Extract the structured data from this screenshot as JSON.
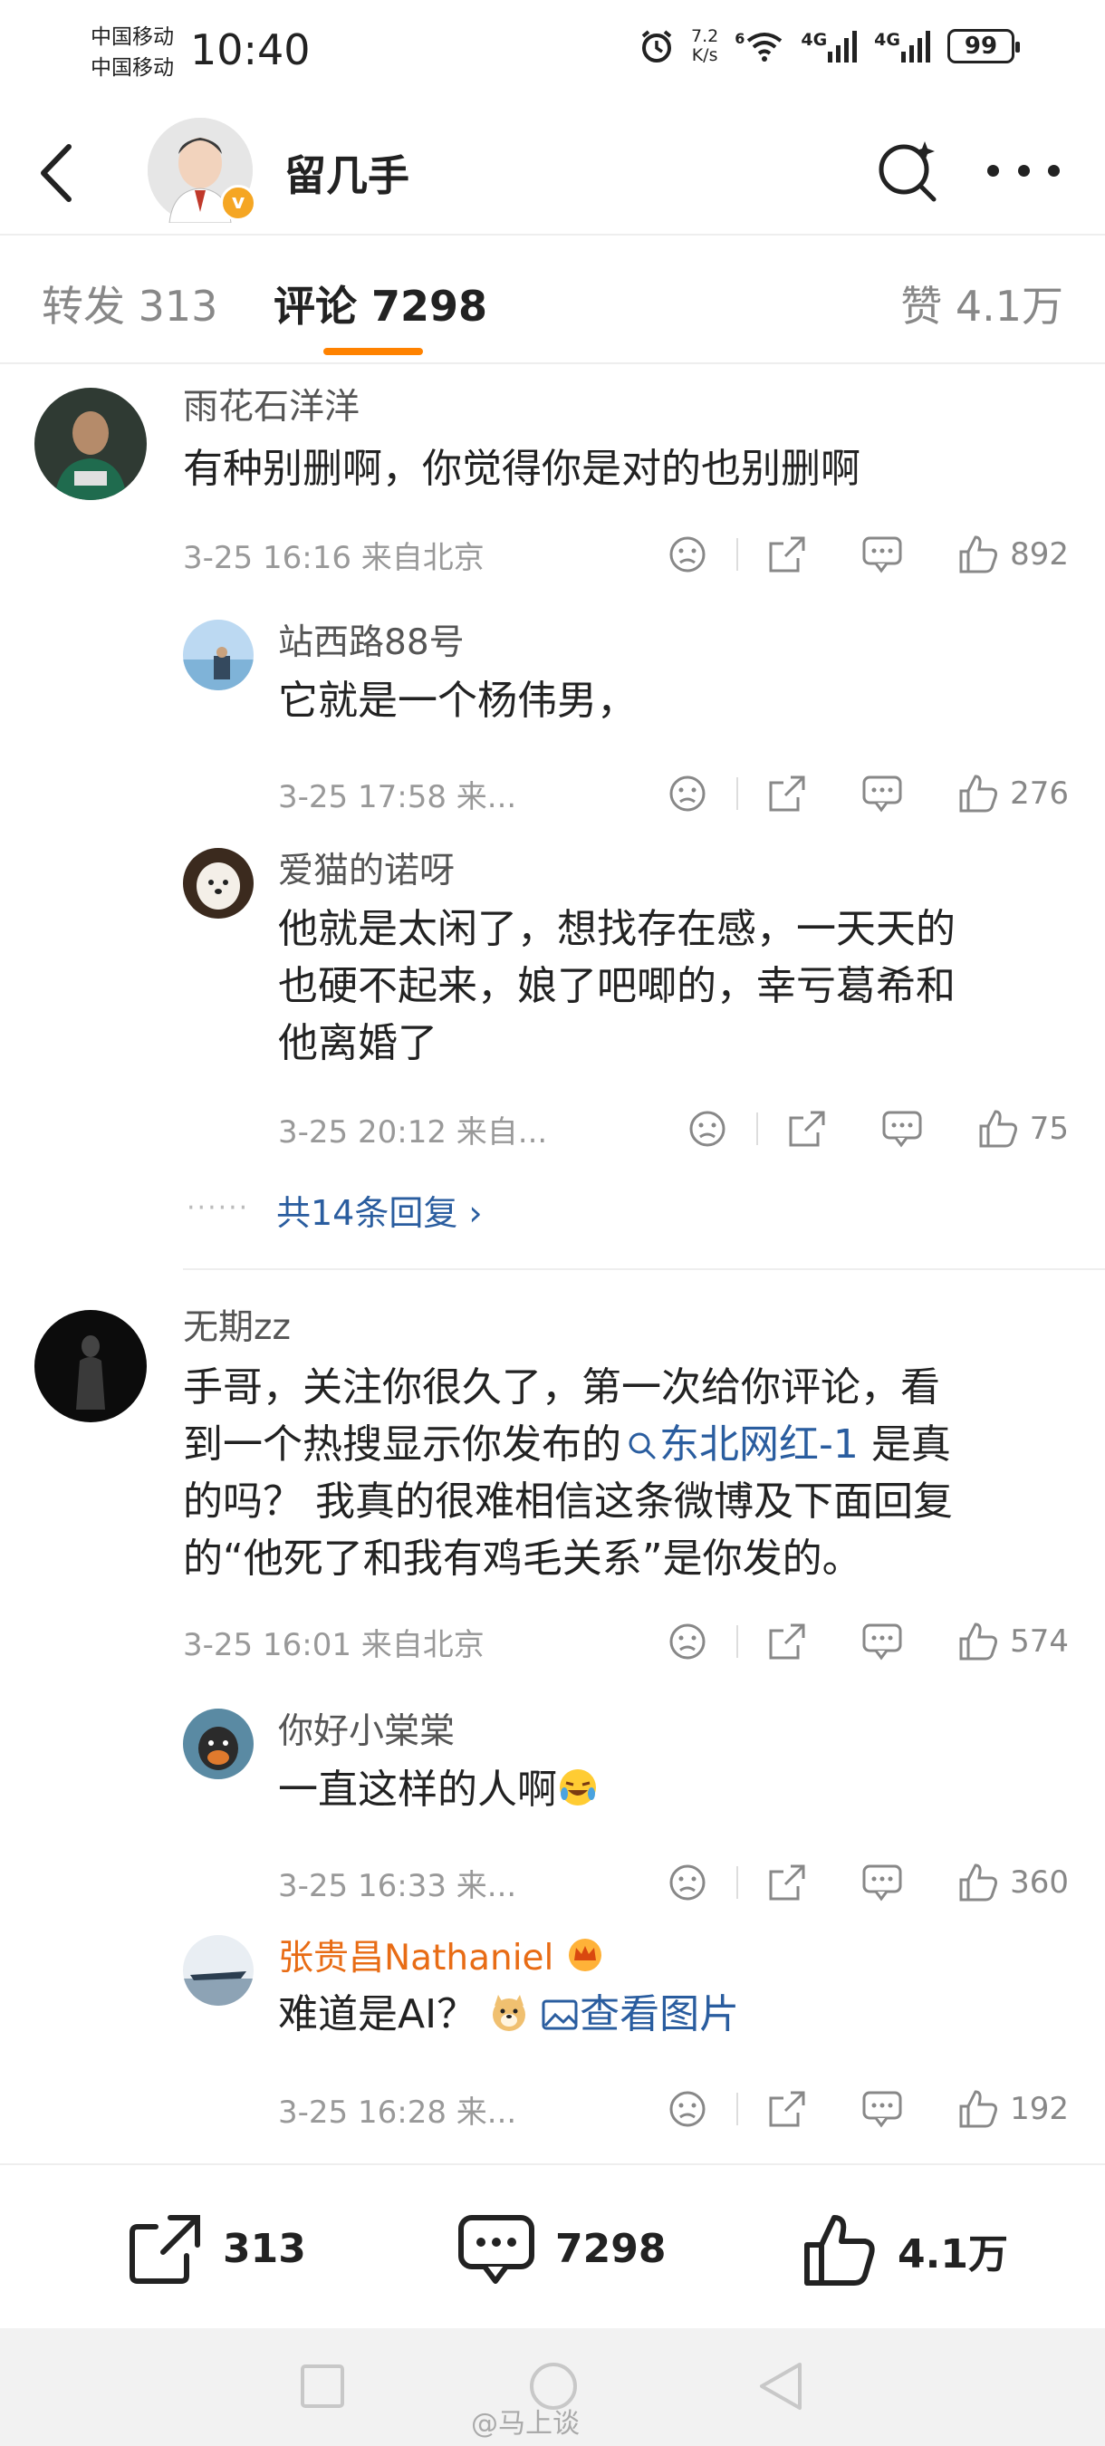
{
  "status_bar": {
    "carrier1": "中国移动",
    "carrier2": "中国移动",
    "time": "10:40",
    "speed_value": "7.2",
    "speed_unit": "K/s",
    "wifi_label": "6",
    "sig1": "4G",
    "sig2": "4G",
    "battery": "99"
  },
  "header": {
    "title": "留几手",
    "verified_badge": "v"
  },
  "tabs": {
    "repost": "转发 313",
    "comment": "评论 7298",
    "like": "赞 4.1万"
  },
  "comments": [
    {
      "name": "雨花石洋洋",
      "text": "有种别删啊，你觉得你是对的也别删啊",
      "meta": "3-25 16:16  来自北京",
      "likes": "892",
      "replies": [
        {
          "name": "站西路88号",
          "text": "它就是一个杨伟男，",
          "meta": "3-25 17:58  来...",
          "likes": "276"
        },
        {
          "name": "爱猫的诺呀",
          "text_lines": [
            "他就是太闲了，想找存在感，一天天的",
            "也硬不起来，娘了吧唧的，幸亏葛希和",
            "他离婚了"
          ],
          "meta": "3-25 20:12  来自...",
          "likes": "75"
        }
      ],
      "more_replies": "共14条回复 ›"
    },
    {
      "name": "无期zz",
      "text_lines": [
        "手哥，关注你很久了，第一次给你评论，看",
        "到一个热搜显示你发布的",
        "是真",
        "的吗？ 我真的很难相信这条微博及下面回复",
        "的“他死了和我有鸡毛关系”是你发的。"
      ],
      "topic_link": "东北网红-1",
      "meta": "3-25 16:01  来自北京",
      "likes": "574",
      "replies": [
        {
          "name": "你好小棠棠",
          "text": "一直这样的人啊",
          "meta": "3-25 16:33  来...",
          "likes": "360"
        },
        {
          "name": "张贵昌Nathaniel",
          "text": "难道是AI？",
          "image_link": "查看图片",
          "meta": "3-25 16:28  来...",
          "likes": "192"
        }
      ]
    }
  ],
  "bottom_bar": {
    "repost": "313",
    "comment": "7298",
    "like": "4.1万"
  },
  "watermark": "@马上谈",
  "colors": {
    "accent": "#ff8200",
    "link": "#2a5d9f",
    "vip_name": "#e86c15"
  }
}
